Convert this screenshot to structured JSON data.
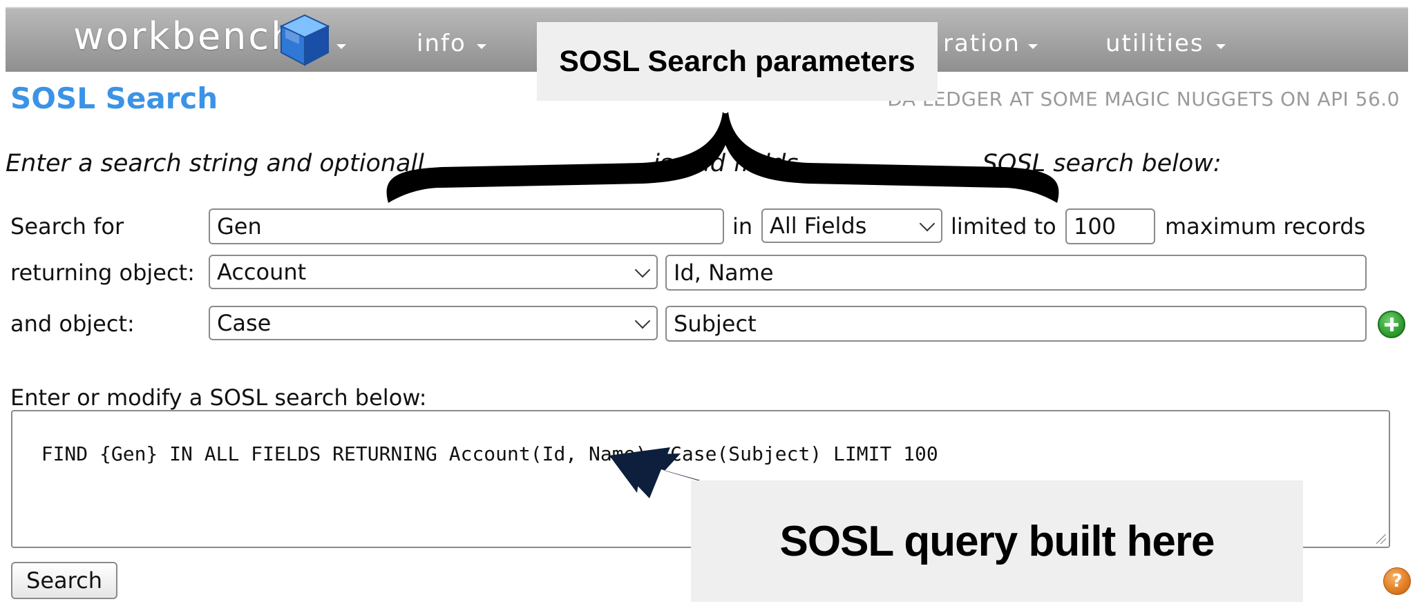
{
  "nav": {
    "logo_text": "workbench",
    "items": [
      {
        "label": "info"
      },
      {
        "label": "ration"
      },
      {
        "label": "utilities"
      }
    ]
  },
  "header": {
    "title": "SOSL Search",
    "org_info": "DA LEDGER AT SOME MAGIC NUGGETS ON API 56.0"
  },
  "instructions": "Enter a search string and optionall",
  "instructions_tail_1": "js and fields",
  "instructions_tail_2": "SOSL search below:",
  "form": {
    "search_for_label": "Search for",
    "search_value": "Gen",
    "in_label": "in",
    "scope_value": "All Fields",
    "limited_to_label": "limited to",
    "limit_value": "100",
    "max_records_label": "maximum records",
    "returning_label": "returning object:",
    "object1_value": "Account",
    "fields1_value": "Id, Name",
    "and_object_label": "and object:",
    "object2_value": "Case",
    "fields2_value": "Subject"
  },
  "query": {
    "label": "Enter or modify a SOSL search below:",
    "value": "FIND {Gen} IN ALL FIELDS RETURNING Account(Id, Name), Case(Subject) LIMIT 100"
  },
  "search_button_label": "Search",
  "help_glyph": "?",
  "annotations": {
    "top_callout": "SOSL Search parameters",
    "bottom_callout": "SOSL query built here"
  },
  "colors": {
    "title_blue": "#3b93e6",
    "navbar_gray": "#a6a6a6",
    "arrow_navy": "#0d1f3c",
    "callout_bg": "#efefef",
    "add_green": "#2f9e2f",
    "help_orange": "#e07a1f"
  },
  "icons": {
    "logo": "workbench-cube-icon",
    "add": "plus-circle-icon",
    "help": "help-icon",
    "dropdown": "chevron-down-icon"
  }
}
